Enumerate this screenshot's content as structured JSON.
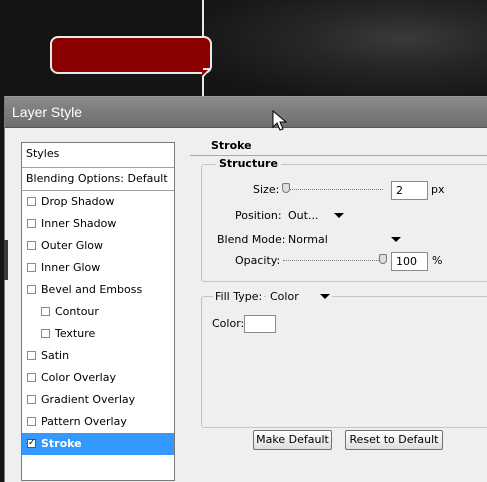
{
  "dialog": {
    "title": "Layer Style"
  },
  "styles_panel": {
    "header": "Styles",
    "blending_options": "Blending Options: Default",
    "items": [
      {
        "label": "Drop Shadow",
        "checked": false
      },
      {
        "label": "Inner Shadow",
        "checked": false
      },
      {
        "label": "Outer Glow",
        "checked": false
      },
      {
        "label": "Inner Glow",
        "checked": false
      },
      {
        "label": "Bevel and Emboss",
        "checked": false
      },
      {
        "label": "Contour",
        "checked": false,
        "indent": true
      },
      {
        "label": "Texture",
        "checked": false,
        "indent": true
      },
      {
        "label": "Satin",
        "checked": false
      },
      {
        "label": "Color Overlay",
        "checked": false
      },
      {
        "label": "Gradient Overlay",
        "checked": false
      },
      {
        "label": "Pattern Overlay",
        "checked": false
      },
      {
        "label": "Stroke",
        "checked": true,
        "selected": true
      }
    ],
    "check_mark": "✓"
  },
  "stroke": {
    "title": "Stroke",
    "structure": {
      "title": "Structure",
      "size_label": "Size:",
      "size_value": "2",
      "size_unit": "px",
      "position_label": "Position:",
      "position_value": "Out...",
      "blend_mode_label": "Blend Mode:",
      "blend_mode_value": "Normal",
      "opacity_label": "Opacity:",
      "opacity_value": "100",
      "opacity_unit": "%"
    },
    "fill": {
      "fill_type_label": "Fill Type:",
      "fill_type_value": "Color",
      "color_label": "Color:",
      "color_value": "#ffffff"
    }
  },
  "buttons": {
    "make_default": "Make Default",
    "reset_to_default": "Reset to Default"
  },
  "colors": {
    "ribbon": "#8b0000",
    "selection": "#3399ff"
  }
}
